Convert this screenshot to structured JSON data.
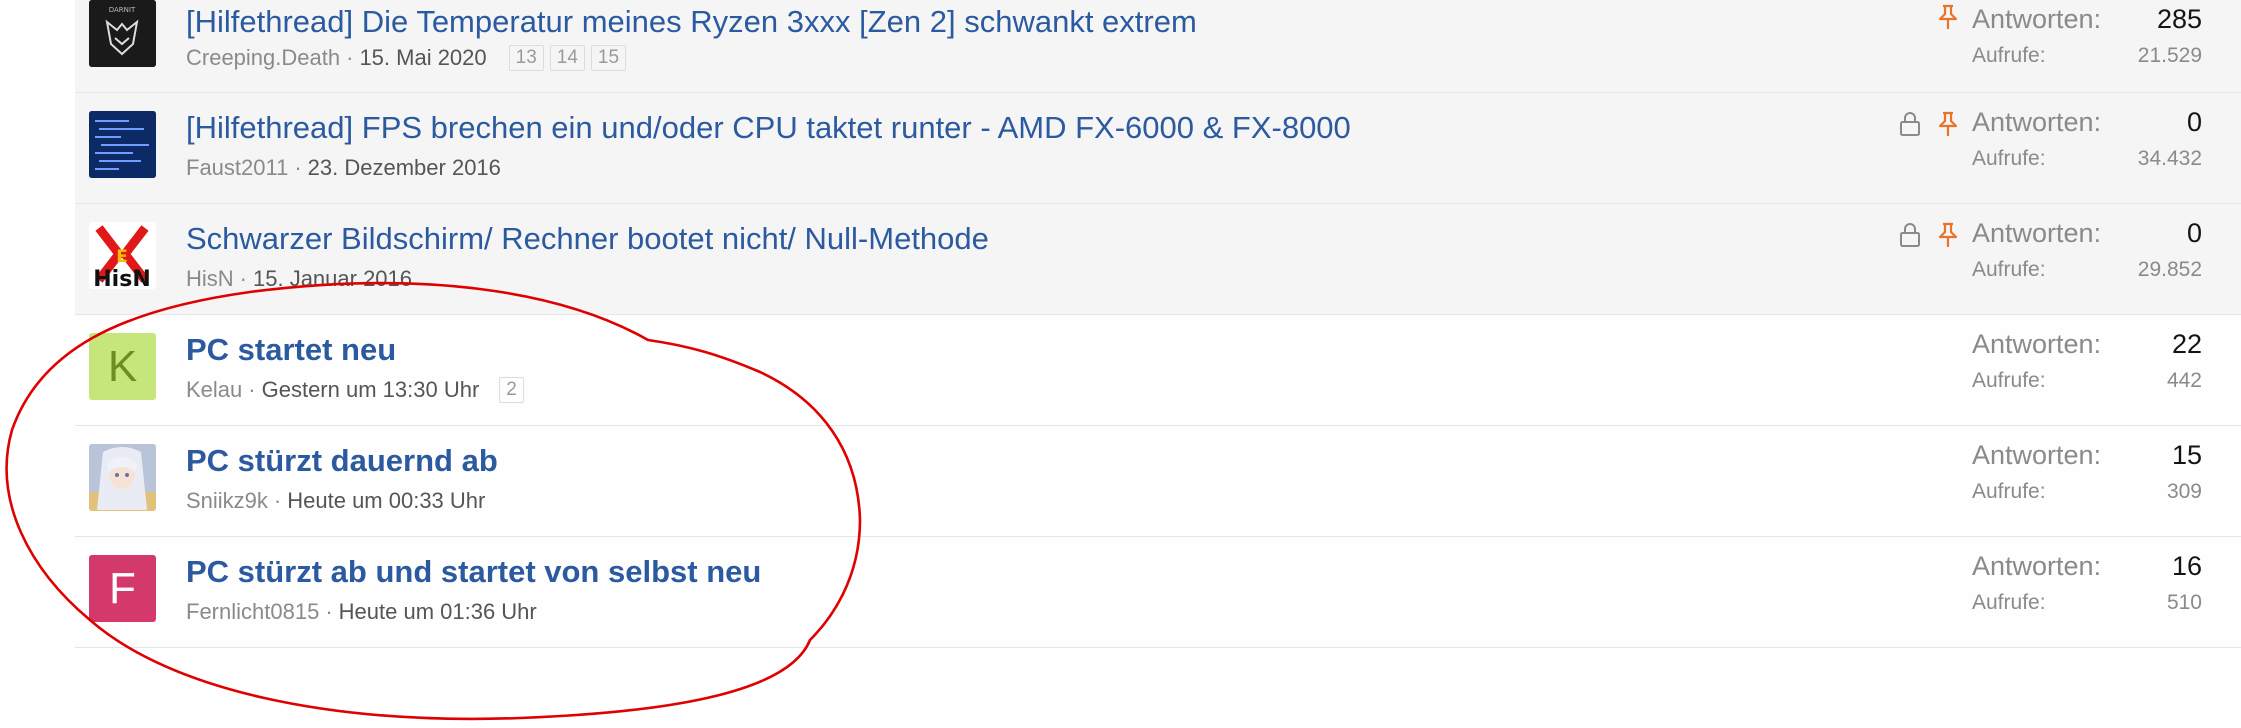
{
  "threads": [
    {
      "title": "[Hilfethread] Die Temperatur meines Ryzen 3xxx [Zen 2] schwankt extrem",
      "author": "Creeping.Death",
      "date": "15. Mai 2020",
      "pages": [
        "13",
        "14",
        "15"
      ],
      "icons": [
        "pin"
      ],
      "replies_label": "Antworten:",
      "replies": "285",
      "views_label": "Aufrufe:",
      "views": "21.529",
      "avatar_text": "DARNIT",
      "avatar_color": "#1a1a1a"
    },
    {
      "title": "[Hilfethread] FPS brechen ein und/oder CPU taktet runter - AMD FX-6000 & FX-8000",
      "author": "Faust2011",
      "date": "23. Dezember 2016",
      "pages": [],
      "icons": [
        "lock",
        "pin"
      ],
      "replies_label": "Antworten:",
      "replies": "0",
      "views_label": "Aufrufe:",
      "views": "34.432",
      "avatar_color": "#1b3b80"
    },
    {
      "title": "Schwarzer Bildschirm/ Rechner bootet nicht/ Null-Methode",
      "author": "HisN",
      "date": "15. Januar 2016",
      "pages": [],
      "icons": [
        "lock",
        "pin"
      ],
      "replies_label": "Antworten:",
      "replies": "0",
      "views_label": "Aufrufe:",
      "views": "29.852",
      "avatar_text": "HisN",
      "avatar_color": "#ffffff"
    },
    {
      "title": "PC startet neu",
      "author": "Kelau",
      "date": "Gestern um 13:30 Uhr",
      "pages": [
        "2"
      ],
      "icons": [],
      "replies_label": "Antworten:",
      "replies": "22",
      "views_label": "Aufrufe:",
      "views": "442",
      "avatar_letter": "K",
      "avatar_color": "#c6e57a",
      "avatar_text_color": "#6b8e23"
    },
    {
      "title": "PC stürzt dauernd ab",
      "author": "Sniikz9k",
      "date": "Heute um 00:33 Uhr",
      "pages": [],
      "icons": [],
      "replies_label": "Antworten:",
      "replies": "15",
      "views_label": "Aufrufe:",
      "views": "309",
      "avatar_color": "#c9cbe0"
    },
    {
      "title": "PC stürzt ab und startet von selbst neu",
      "author": "Fernlicht0815",
      "date": "Heute um 01:36 Uhr",
      "pages": [],
      "icons": [],
      "replies_label": "Antworten:",
      "replies": "16",
      "views_label": "Aufrufe:",
      "views": "510",
      "avatar_letter": "F",
      "avatar_color": "#d33a6b",
      "avatar_text_color": "#ffffff"
    }
  ],
  "colors": {
    "link": "#2b5aa0",
    "pin": "#e8742a",
    "lock": "#8a8a8a",
    "annotation": "#e00000"
  }
}
